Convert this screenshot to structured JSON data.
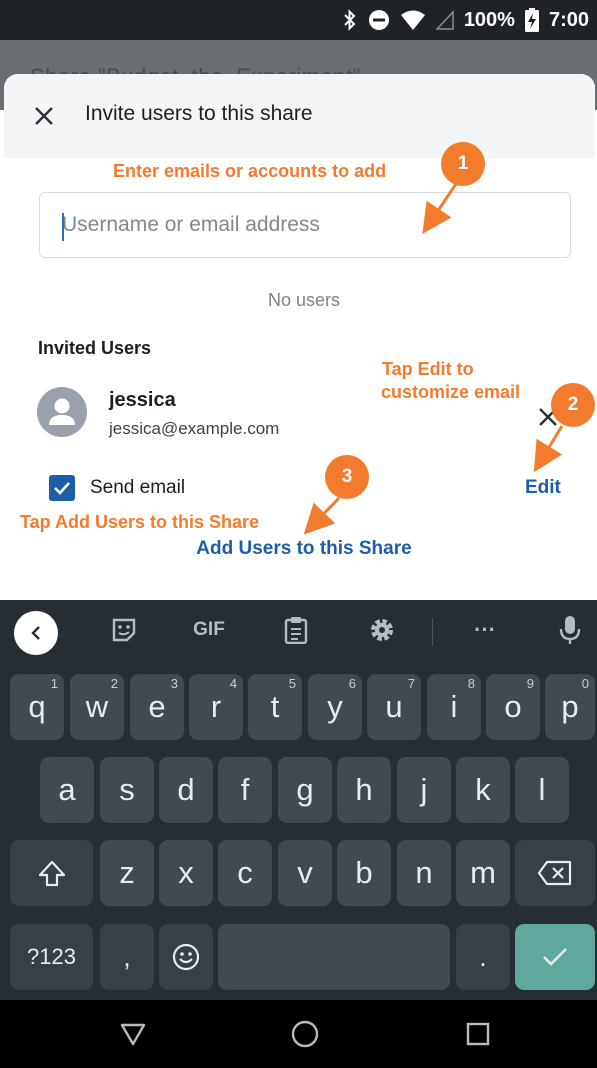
{
  "status_bar": {
    "battery": "100%",
    "time": "7:00"
  },
  "background_title": "Share \"Budget_the_Experiment\"",
  "dialog": {
    "title": "Invite users to this share",
    "search_placeholder": "Username or email address",
    "empty_text": "No users",
    "invited_heading": "Invited Users",
    "user": {
      "name": "jessica",
      "email": "jessica@example.com"
    },
    "send_email_label": "Send email",
    "send_email_checked": true,
    "edit_label": "Edit",
    "add_users_label": "Add Users to this Share"
  },
  "annotations": {
    "a1": "Enter emails or accounts to add",
    "a2_line1": "Tap Edit to",
    "a2_line2": "customize email",
    "a3": "Tap Add Users to this Share",
    "n1": "1",
    "n2": "2",
    "n3": "3"
  },
  "colors": {
    "annotation": "#f37b2e",
    "link": "#1e5ea8",
    "enter_key": "#5fa89c"
  },
  "keyboard": {
    "toolbar": {
      "gif": "GIF",
      "more": "···"
    },
    "row1": [
      {
        "k": "q",
        "h": "1"
      },
      {
        "k": "w",
        "h": "2"
      },
      {
        "k": "e",
        "h": "3"
      },
      {
        "k": "r",
        "h": "4"
      },
      {
        "k": "t",
        "h": "5"
      },
      {
        "k": "y",
        "h": "6"
      },
      {
        "k": "u",
        "h": "7"
      },
      {
        "k": "i",
        "h": "8"
      },
      {
        "k": "o",
        "h": "9"
      },
      {
        "k": "p",
        "h": "0"
      }
    ],
    "row2": [
      "a",
      "s",
      "d",
      "f",
      "g",
      "h",
      "j",
      "k",
      "l"
    ],
    "row3": [
      "z",
      "x",
      "c",
      "v",
      "b",
      "n",
      "m"
    ],
    "symbols": "?123",
    "comma": ",",
    "period": "."
  }
}
